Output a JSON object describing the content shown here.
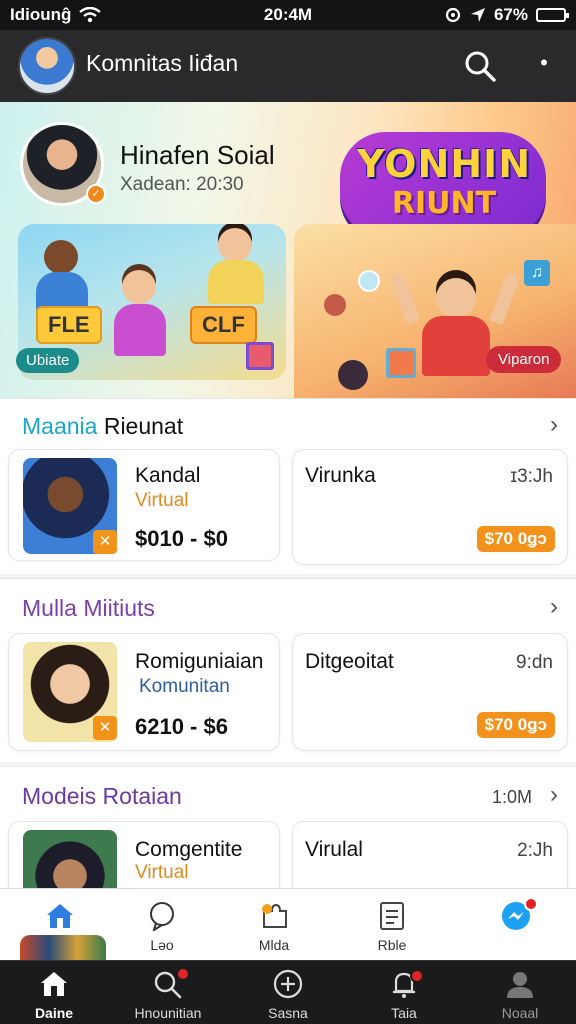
{
  "status_bar": {
    "carrier": "Idiounĝ",
    "time": "20:4M",
    "battery": "67%"
  },
  "header": {
    "title": "Komnitas Iiđan"
  },
  "hero": {
    "name": "Hinafen Soial",
    "subtitle": "Xadean: 20:30",
    "banner_line1": "YONHIN",
    "banner_line2": "RIUNT",
    "card_left_tag1": "FLE",
    "card_left_tag2": "CLF",
    "card_left_chip": "Ubiate",
    "card_right_chip": "Viparon"
  },
  "sections": [
    {
      "title_prefix": "Maania",
      "title_rest": " Rieunat",
      "title_color": "#1ba7c9",
      "item": {
        "name": "Kandal",
        "sub": "Virtual",
        "price": "$010 - $0"
      },
      "side": {
        "name": "Virunka",
        "time": "ɪ3:Jh",
        "price": "$70 0ǥɔ"
      }
    },
    {
      "title_prefix": "Mulla",
      "title_rest": " Miitiuts",
      "title_color": "#7a3fa8",
      "item": {
        "name": "Romiguniaian",
        "sub": "Komunitan",
        "price": "6210 - $6"
      },
      "side": {
        "name": "Ditgeoitat",
        "time": "9:dn",
        "price": "$70 0ǥɔ"
      }
    },
    {
      "title_prefix": "Modeis",
      "title_rest": " Rotaian",
      "title_color": "#6b3aa0",
      "meta": "1:0M",
      "item": {
        "name": "Comgentite",
        "sub": "Virtual"
      },
      "side": {
        "name": "Virulal",
        "time": "2:Jh"
      }
    }
  ],
  "tabbar_top": [
    {
      "label": "Lǝo"
    },
    {
      "label": "Mlda"
    },
    {
      "label": "Rble"
    }
  ],
  "bottom_nav": [
    {
      "label": "Daine"
    },
    {
      "label": "Hnounitian"
    },
    {
      "label": "Sasna"
    },
    {
      "label": "Taia"
    },
    {
      "label": "Noaal"
    }
  ],
  "colors": {
    "accent_orange": "#f2921c",
    "header_bg": "#2a2a2c",
    "home_blue": "#2f7de1",
    "banner_purple": "#9b34d1"
  },
  "icons": {
    "status": [
      "wifi-icon",
      "location-icon",
      "battery-icon"
    ],
    "header": [
      "search-icon",
      "more-icon"
    ],
    "tabbar_top": [
      "home-icon",
      "chat-icon",
      "puzzle-icon",
      "document-icon",
      "messenger-icon"
    ],
    "bottom_nav": [
      "home-icon",
      "search-icon",
      "add-circle-icon",
      "bell-icon",
      "user-icon"
    ]
  }
}
